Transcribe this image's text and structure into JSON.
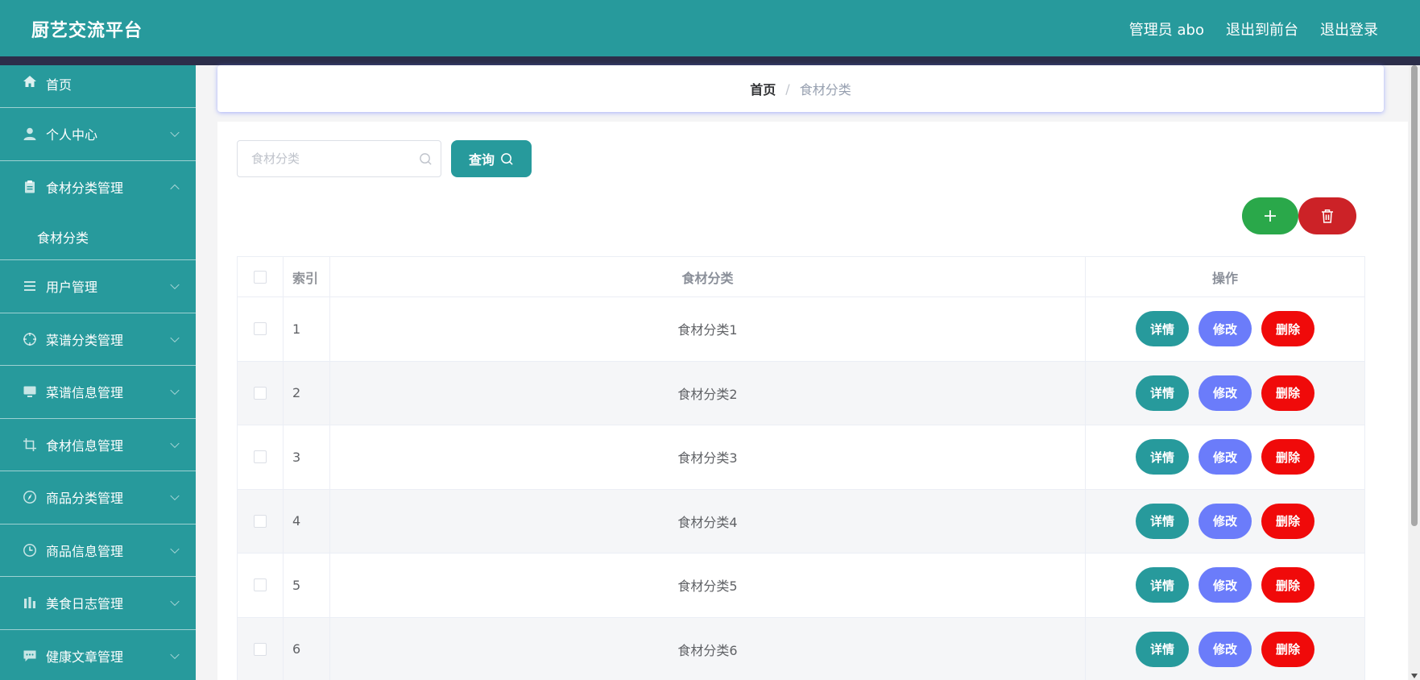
{
  "header": {
    "brand": "厨艺交流平台",
    "admin_label": "管理员 abo",
    "to_front_label": "退出到前台",
    "logout_label": "退出登录"
  },
  "sidebar": {
    "items": [
      {
        "label": "首页",
        "icon": "home-icon"
      },
      {
        "label": "个人中心",
        "icon": "user-icon"
      },
      {
        "label": "食材分类管理",
        "icon": "clipboard-icon",
        "expanded": true,
        "sub": [
          "食材分类"
        ]
      },
      {
        "label": "用户管理",
        "icon": "list-icon"
      },
      {
        "label": "菜谱分类管理",
        "icon": "crosshair-icon"
      },
      {
        "label": "菜谱信息管理",
        "icon": "monitor-icon"
      },
      {
        "label": "食材信息管理",
        "icon": "crop-icon"
      },
      {
        "label": "商品分类管理",
        "icon": "compass-icon"
      },
      {
        "label": "商品信息管理",
        "icon": "clock-icon"
      },
      {
        "label": "美食日志管理",
        "icon": "bar-chart-icon"
      },
      {
        "label": "健康文章管理",
        "icon": "chat-icon"
      }
    ]
  },
  "breadcrumb": {
    "home": "首页",
    "separator": "/",
    "current": "食材分类"
  },
  "search": {
    "placeholder": "食材分类",
    "value": "",
    "button_label": "查询"
  },
  "table": {
    "columns": [
      "索引",
      "食材分类",
      "操作"
    ],
    "rows": [
      {
        "index": "1",
        "name": "食材分类1"
      },
      {
        "index": "2",
        "name": "食材分类2"
      },
      {
        "index": "3",
        "name": "食材分类3"
      },
      {
        "index": "4",
        "name": "食材分类4"
      },
      {
        "index": "5",
        "name": "食材分类5"
      },
      {
        "index": "6",
        "name": "食材分类6"
      }
    ],
    "actions": {
      "detail": "详情",
      "edit": "修改",
      "delete": "删除"
    }
  },
  "colors": {
    "primary": "#279a9c",
    "header_band": "#2c2e4a",
    "add": "#2aa84a",
    "bulk_delete": "#cc2227",
    "edit": "#6b7cfa",
    "delete": "#f00a0a"
  }
}
